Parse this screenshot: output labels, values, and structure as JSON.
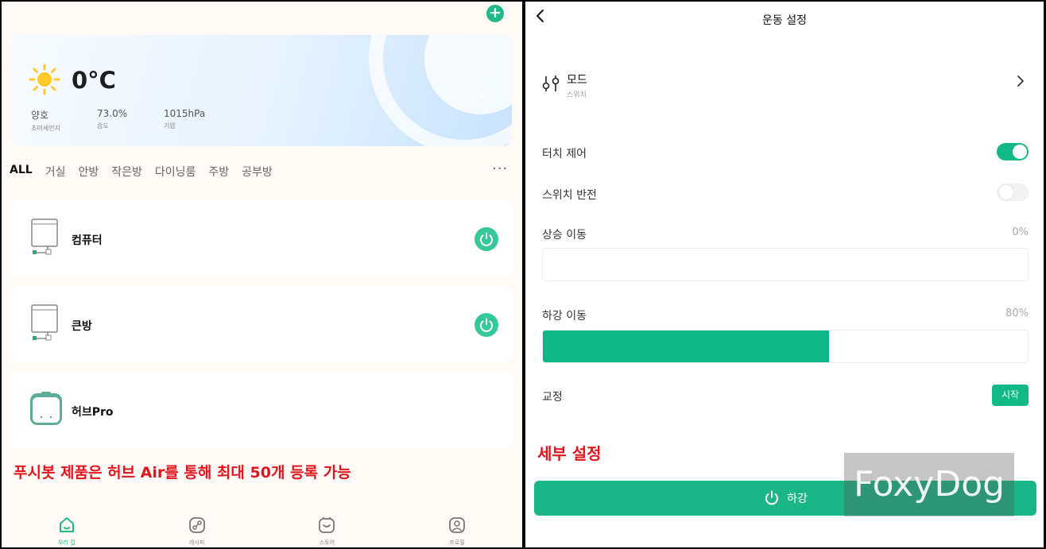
{
  "left": {
    "add_button": "+",
    "weather": {
      "temperature": "0°C",
      "stats": [
        {
          "value": "양호",
          "label": "초미세먼지"
        },
        {
          "value": "73.0%",
          "label": "습도"
        },
        {
          "value": "1015hPa",
          "label": "기압"
        }
      ]
    },
    "tabs": [
      "ALL",
      "거실",
      "안방",
      "작은방",
      "다이닝룸",
      "주방",
      "공부방"
    ],
    "more": "···",
    "devices": [
      {
        "name": "컴퓨터",
        "icon": "curtain-bot-icon",
        "has_power": true
      },
      {
        "name": "큰방",
        "icon": "curtain-bot-icon",
        "has_power": true
      },
      {
        "name": "허브Pro",
        "icon": "hub-icon",
        "has_power": false
      }
    ],
    "note": "푸시봇 제품은 허브 Air를 통해 최대 50개 등록 가능",
    "bottom_nav": [
      {
        "label": "우리 집",
        "icon": "home-icon",
        "active": true
      },
      {
        "label": "레시피",
        "icon": "recipe-icon",
        "active": false
      },
      {
        "label": "스토어",
        "icon": "store-icon",
        "active": false
      },
      {
        "label": "프로필",
        "icon": "profile-icon",
        "active": false
      }
    ]
  },
  "right": {
    "title": "운동 설정",
    "mode": {
      "label": "모드",
      "sub": "스위치"
    },
    "touch_control": {
      "label": "터치 제어",
      "on": true
    },
    "switch_invert": {
      "label": "스위치 반전",
      "on": false
    },
    "move_up": {
      "label": "상승 이동",
      "value": "0%",
      "fraction": 0.0
    },
    "move_down": {
      "label": "하강 이동",
      "value": "80%",
      "fraction": 0.59
    },
    "calibration": {
      "label": "교정",
      "button": "시작"
    },
    "detail_note": "세부 설정",
    "down_button": "하강",
    "watermark": "FoxyDog"
  },
  "colors": {
    "accent": "#12b886",
    "note_red": "#e3141b"
  }
}
